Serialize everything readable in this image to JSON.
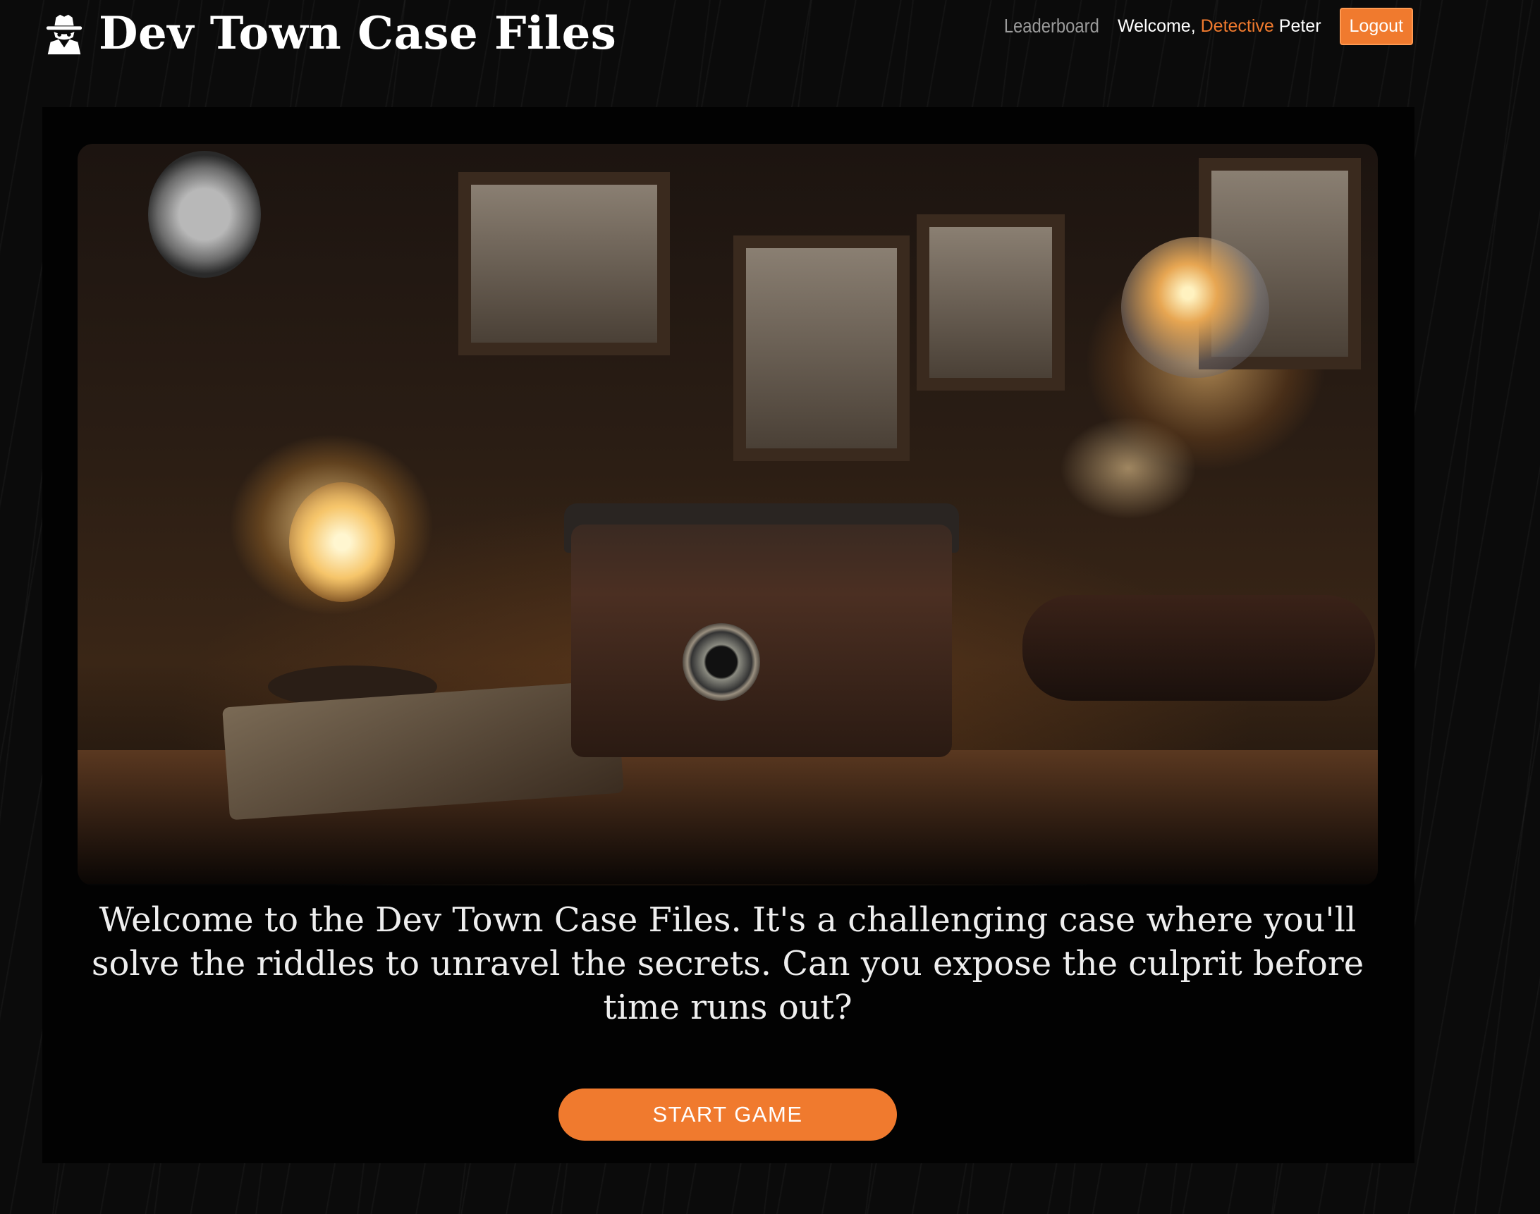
{
  "app": {
    "title": "Dev Town Case Files",
    "logo_icon": "detective-icon"
  },
  "nav": {
    "leaderboard_label": "Leaderboard",
    "welcome_prefix": "Welcome, ",
    "rank": "Detective",
    "username": " Peter",
    "logout_label": "Logout"
  },
  "hero": {
    "image_icon": "detective-desk-illustration"
  },
  "intro": {
    "text": "Welcome to the Dev Town Case Files. It's a challenging case where you'll solve the riddles to unravel the secrets. Can you expose the culprit before time runs out?"
  },
  "actions": {
    "start_label": "START GAME"
  },
  "colors": {
    "accent": "#f07a2e",
    "background": "#080808",
    "panel": "#020202"
  }
}
